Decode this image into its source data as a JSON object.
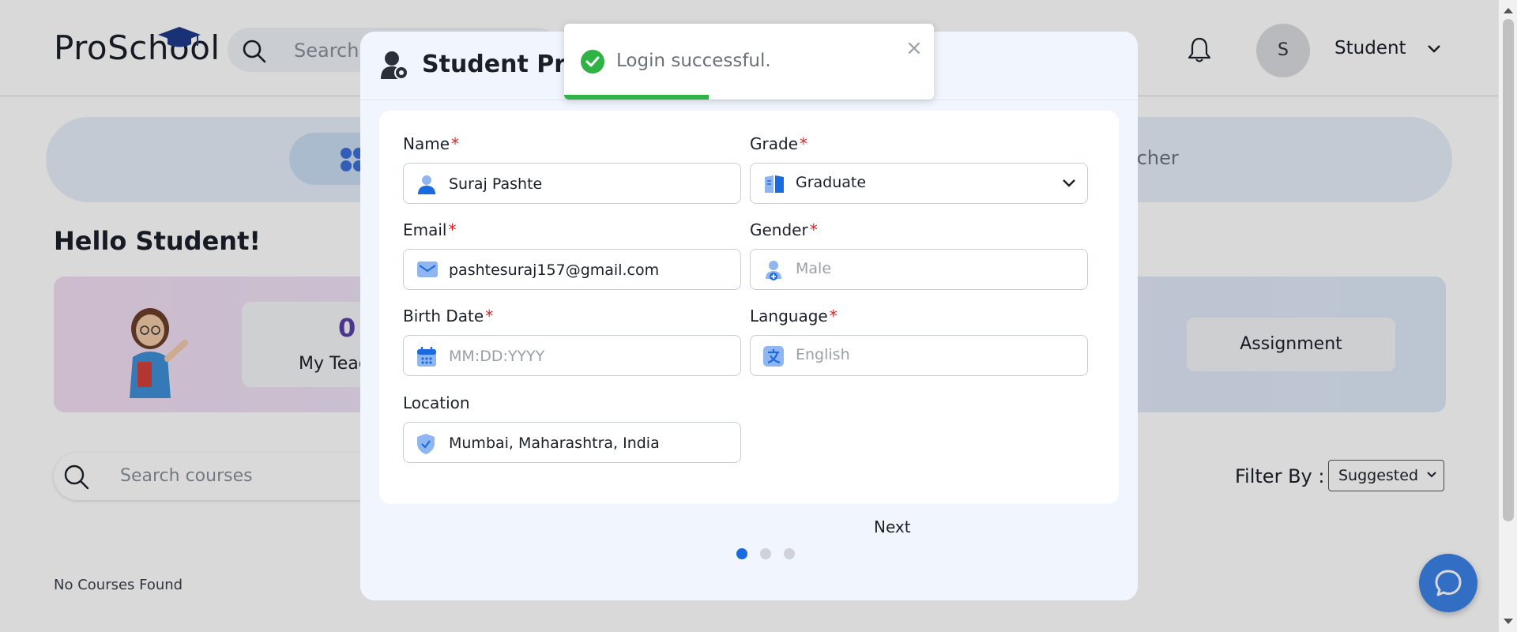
{
  "app": {
    "logo": "ProSchool",
    "search_placeholder": "Search",
    "user_initial": "S",
    "user_name": "Student"
  },
  "tabs": {
    "teacher_partial": "acher"
  },
  "greeting": "Hello Student!",
  "hero": {
    "stat_value": "0",
    "stat_label": "My Teachers",
    "assignment_label": "Assignment"
  },
  "courses": {
    "search_placeholder": "Search courses",
    "filter_label": "Filter By :",
    "filter_value": "Suggested",
    "empty_text": "No Courses Found"
  },
  "modal": {
    "title": "Student Profile",
    "fields": {
      "name": {
        "label": "Name",
        "value": "Suraj Pashte",
        "required": true
      },
      "grade": {
        "label": "Grade",
        "value": "Graduate",
        "required": true
      },
      "email": {
        "label": "Email",
        "value": "pashtesuraj157@gmail.com",
        "required": true
      },
      "gender": {
        "label": "Gender",
        "placeholder": "Male",
        "required": true
      },
      "birth_date": {
        "label": "Birth Date",
        "placeholder": "MM:DD:YYYY",
        "required": true
      },
      "language": {
        "label": "Language",
        "placeholder": "English",
        "required": true
      },
      "location": {
        "label": "Location",
        "value": "Mumbai, Maharashtra, India",
        "required": false
      }
    },
    "required_mark": "*",
    "steps": {
      "total": 3,
      "current": 1
    },
    "next_label": "Next"
  },
  "toast": {
    "message": "Login successful.",
    "close_glyph": "×",
    "progress": 0.39,
    "colors": {
      "success": "#2fb344"
    }
  },
  "colors": {
    "accent": "#3b82e6",
    "active_dot": "#1a6be0",
    "required": "#e02424",
    "stat_number": "#5b3fa8"
  }
}
